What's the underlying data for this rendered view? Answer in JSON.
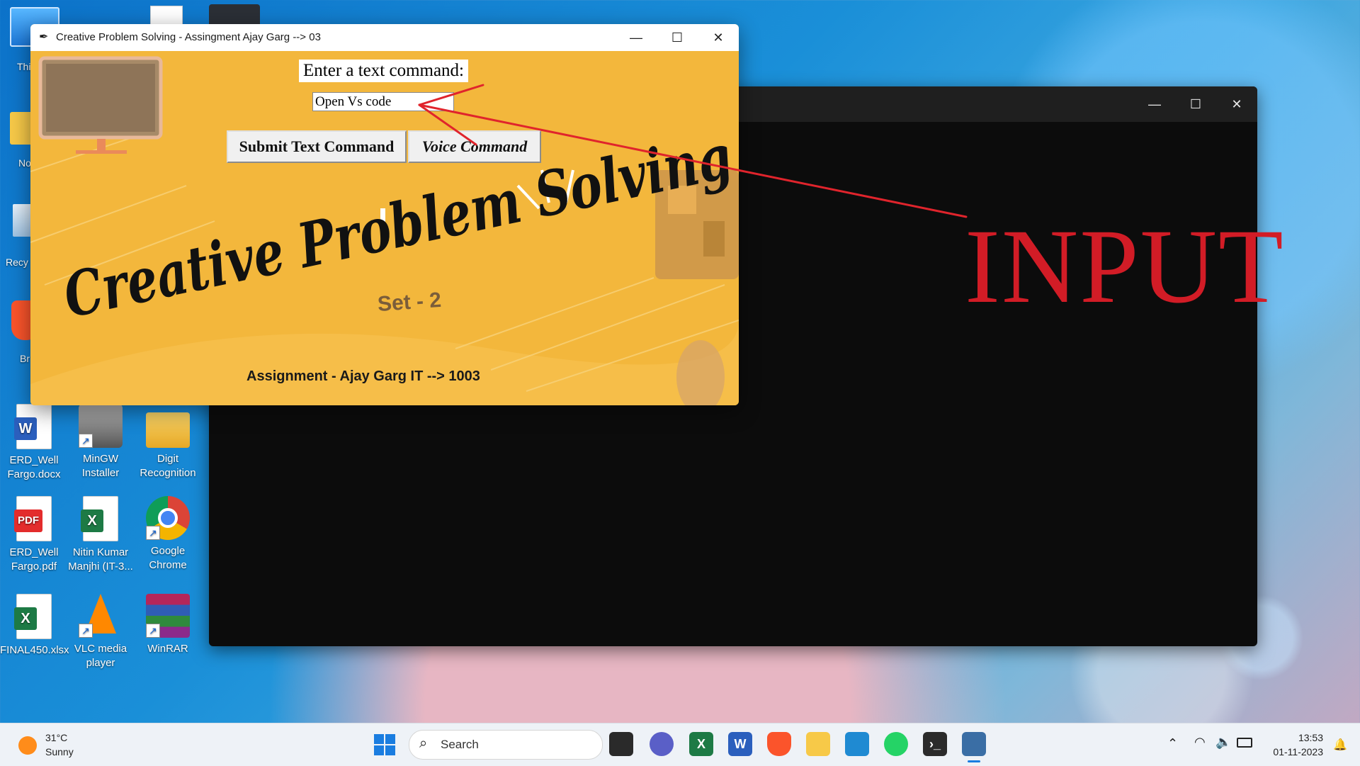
{
  "desktop": {
    "icons": [
      {
        "label_line1": "ERD_Well",
        "label_line2": "Fargo.docx",
        "icon": "word-doc-icon",
        "badge": "W"
      },
      {
        "label_line1": "MinGW",
        "label_line2": "Installer",
        "icon": "installer-icon"
      },
      {
        "label_line1": "Digit",
        "label_line2": "Recognition",
        "icon": "folder-icon"
      },
      {
        "label_line1": "ERD_Well",
        "label_line2": "Fargo.pdf",
        "icon": "pdf-icon",
        "badge": "PDF"
      },
      {
        "label_line1": "Nitin Kumar",
        "label_line2": "Manjhi (IT-3...",
        "icon": "excel-doc-icon",
        "badge": "X"
      },
      {
        "label_line1": "Google",
        "label_line2": "Chrome",
        "icon": "chrome-icon"
      },
      {
        "label_line1": "FINAL450.xlsx",
        "label_line2": "",
        "icon": "excel-doc-icon",
        "badge": "X"
      },
      {
        "label_line1": "VLC media",
        "label_line2": "player",
        "icon": "vlc-icon"
      },
      {
        "label_line1": "WinRAR",
        "label_line2": "",
        "icon": "winrar-icon"
      }
    ],
    "partial_labels": [
      "Thi",
      "No",
      "Recy",
      "Br"
    ]
  },
  "app_window": {
    "title": "Creative Problem Solving - Assingment Ajay Garg --> 03",
    "prompt_label": "Enter a text command:",
    "input_value": "Open Vs code",
    "submit_button": "Submit Text Command",
    "voice_button": "Voice Command",
    "banner_title": "Creative Problem Solving",
    "banner_subtitle": "Set - 2",
    "footer": "Assignment - Ajay Garg IT --> 1003"
  },
  "annotation": {
    "text": "INPUT",
    "color": "#d21c26"
  },
  "taskbar": {
    "weather_temp": "31°C",
    "weather_desc": "Sunny",
    "search_label": "Search",
    "time": "13:53",
    "date": "01-11-2023",
    "pinned": [
      "task-view-icon",
      "teams-icon",
      "excel-icon",
      "word-icon",
      "brave-icon",
      "file-explorer-icon",
      "vscode-icon",
      "whatsapp-icon",
      "terminal-icon",
      "python-tk-icon"
    ]
  }
}
